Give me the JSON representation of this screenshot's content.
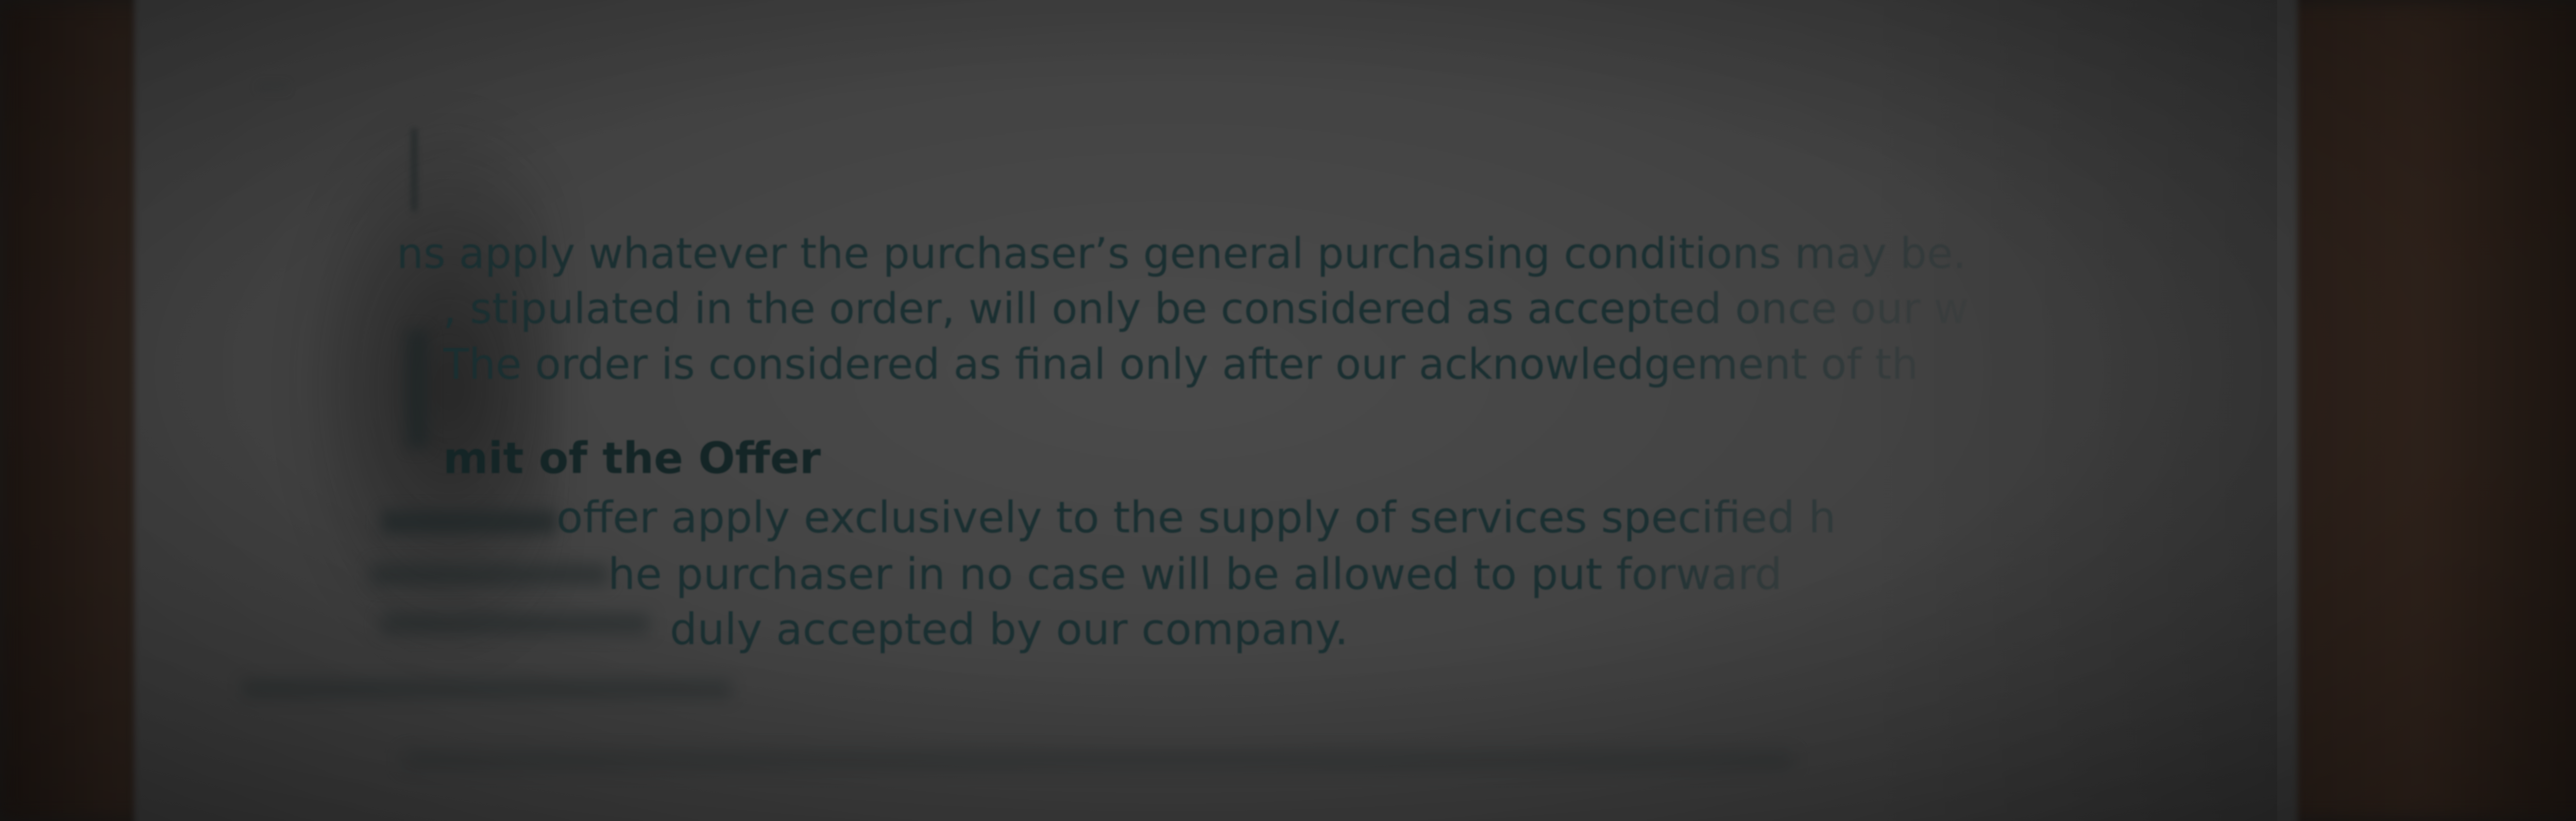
{
  "document": {
    "top_label": "...",
    "lines": [
      "ns apply whatever the purchaser’s general purchasing conditions may be.",
      ", stipulated in the order, will only be considered as accepted once our w",
      "The order is considered as final only after our acknowledgement of th"
    ],
    "heading": "mit of the Offer",
    "offer_lines": [
      "offer apply exclusively to the supply of services specified h",
      "he purchaser in no case will be allowed to put forward",
      "duly accepted by our company."
    ],
    "blurred_lines": [
      "",
      ""
    ]
  }
}
